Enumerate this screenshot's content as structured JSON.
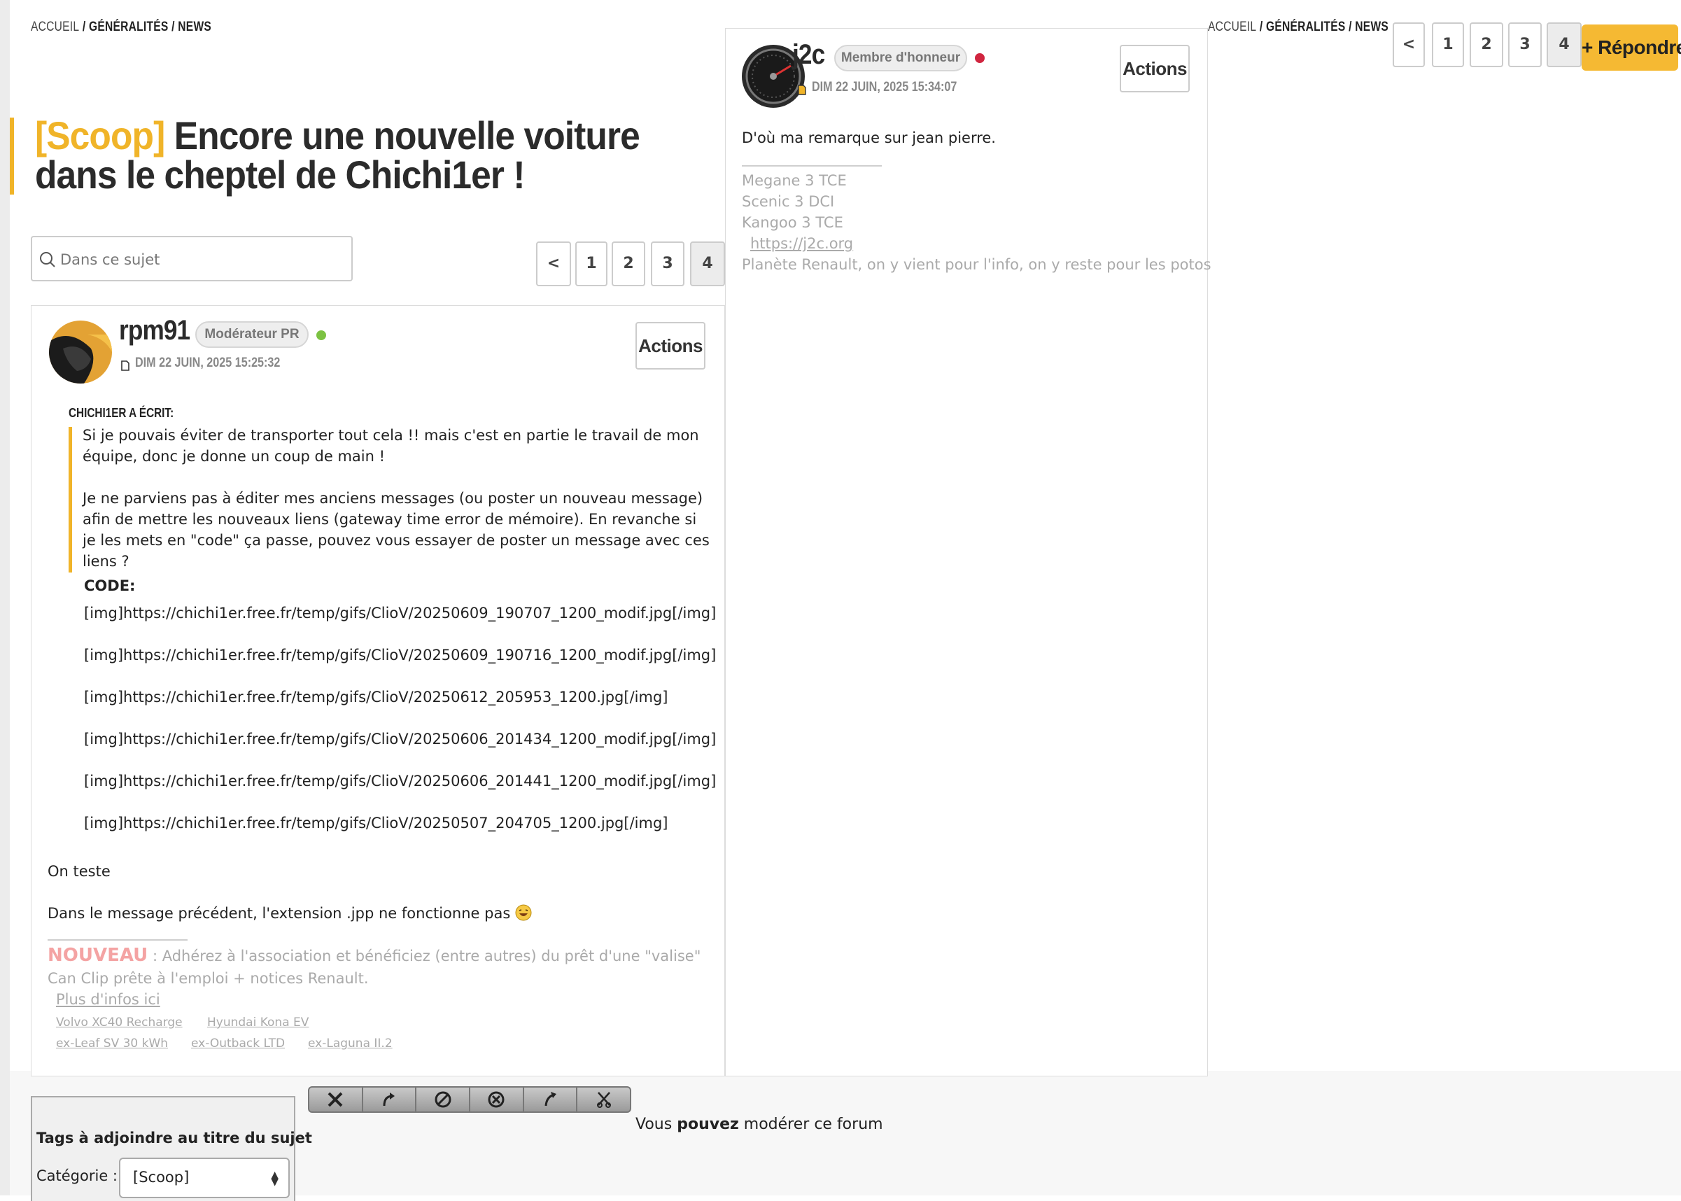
{
  "breadcrumb": {
    "home": "Accueil",
    "sep": "/",
    "section": "Généralités",
    "forum": "News"
  },
  "topic": {
    "tag": "[Scoop]",
    "title": "Encore une nouvelle voiture dans le cheptel de Chichi1er !"
  },
  "search": {
    "placeholder": "Dans ce sujet"
  },
  "pagination": {
    "prev": "<",
    "pages": [
      "1",
      "2",
      "3",
      "4"
    ],
    "current": "4"
  },
  "reply_button": "+ Répondre",
  "post1": {
    "username": "rpm91",
    "role": "Modérateur PR",
    "status_color": "#7cc242",
    "date": "Dim 22 juin, 2025 15:25:32",
    "actions_label": "Actions",
    "quote": {
      "author": "Chichi1er a écrit:",
      "text_1": "Si je pouvais éviter de transporter tout cela !! mais c'est en partie le travail de mon équipe, donc je donne un coup de main !",
      "text_2": "Je ne parviens pas à éditer mes anciens messages (ou poster un nouveau message) afin de mettre les nouveaux liens (gateway time error de mémoire). En revanche si je les mets en \"code\" ça passe, pouvez vous essayer de poster un message avec ces liens ?",
      "code_label": "CODE:",
      "code_lines": [
        "[img]https://chichi1er.free.fr/temp/gifs/ClioV/20250609_190707_1200_modif.jpg[/img]",
        "[img]https://chichi1er.free.fr/temp/gifs/ClioV/20250609_190716_1200_modif.jpg[/img]",
        "[img]https://chichi1er.free.fr/temp/gifs/ClioV/20250612_205953_1200.jpg[/img]",
        "[img]https://chichi1er.free.fr/temp/gifs/ClioV/20250606_201434_1200_modif.jpg[/img]",
        "[img]https://chichi1er.free.fr/temp/gifs/ClioV/20250606_201441_1200_modif.jpg[/img]",
        "[img]https://chichi1er.free.fr/temp/gifs/ClioV/20250507_204705_1200.jpg[/img]"
      ]
    },
    "body_1": "On teste",
    "body_2": "Dans le message précédent, l'extension .jpp ne fonctionne pas",
    "signature": {
      "nouveau": "NOUVEAU",
      "line_1": " : Adhérez à l'association et bénéficiez (entre autres) du prêt d'une \"valise\"",
      "line_2": "Can Clip prête à l'emploi + notices Renault.",
      "link": "Plus d'infos ici",
      "cars": [
        "Volvo XC40 Recharge",
        "Hyundai Kona EV",
        "ex-Leaf SV 30 kWh",
        "ex-Outback LTD",
        "ex-Laguna II.2"
      ]
    }
  },
  "post2": {
    "username": "j2c",
    "role": "Membre d'honneur",
    "status_color": "#d0253f",
    "date": "Dim 22 juin, 2025 15:34:07",
    "actions_label": "Actions",
    "body": "D'où ma remarque sur jean pierre.",
    "signature": {
      "cars": [
        "Megane 3 TCE",
        "Scenic 3 DCI",
        "Kangoo 3 TCE"
      ],
      "link": "https://j2c.org",
      "motto": "Planète Renault, on y vient pour l'info, on y reste pour les potos"
    }
  },
  "moderation": {
    "tools": [
      "delete-icon",
      "move-icon",
      "lock-icon",
      "close-topic-icon",
      "redirect-icon",
      "split-icon"
    ],
    "text_prefix": "Vous ",
    "text_bold": "pouvez",
    "text_suffix": " modérer ce forum"
  },
  "tags_box": {
    "title": "Tags à  adjoindre au titre du sujet",
    "category_label": "Catégorie :",
    "category_value": "[Scoop]"
  },
  "colors": {
    "accent": "#f0b429",
    "reply_button": "#f5b933",
    "nouveau": "#f4a3a3"
  }
}
